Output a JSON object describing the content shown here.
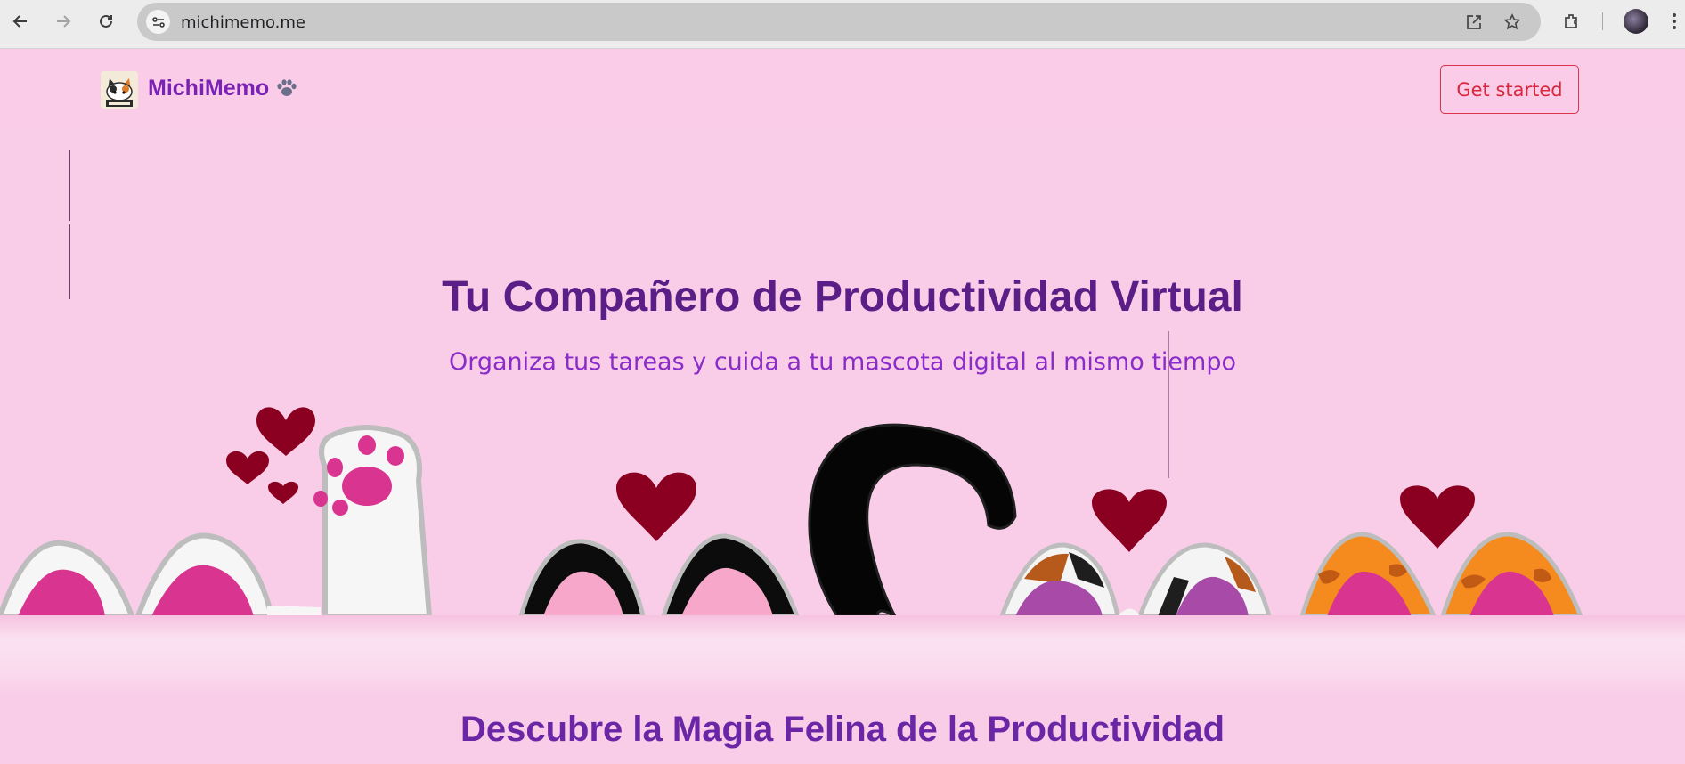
{
  "browser": {
    "url": "michimemo.me",
    "icons": [
      "back-icon",
      "forward-icon",
      "reload-icon",
      "site-info-icon",
      "open-in-app-icon",
      "bookmark-star-icon",
      "extensions-icon",
      "profile-avatar",
      "menu-icon"
    ]
  },
  "header": {
    "brand": "MichiMemo",
    "brand_emoji": "🐾",
    "cta_label": "Get started"
  },
  "hero": {
    "title": "Tu Compañero de Productividad Virtual",
    "subtitle": "Organiza tus tareas y cuida a tu mascota digital al mismo tiempo"
  },
  "features": {
    "title": "Descubre la Magia Felina de la Productividad"
  },
  "colors": {
    "page_bg": "#f9cde8",
    "brand": "#7a22b5",
    "cta": "#d6283f",
    "title": "#5a1e86",
    "subtitle": "#8a2cc7",
    "heart": "#8b0020"
  }
}
